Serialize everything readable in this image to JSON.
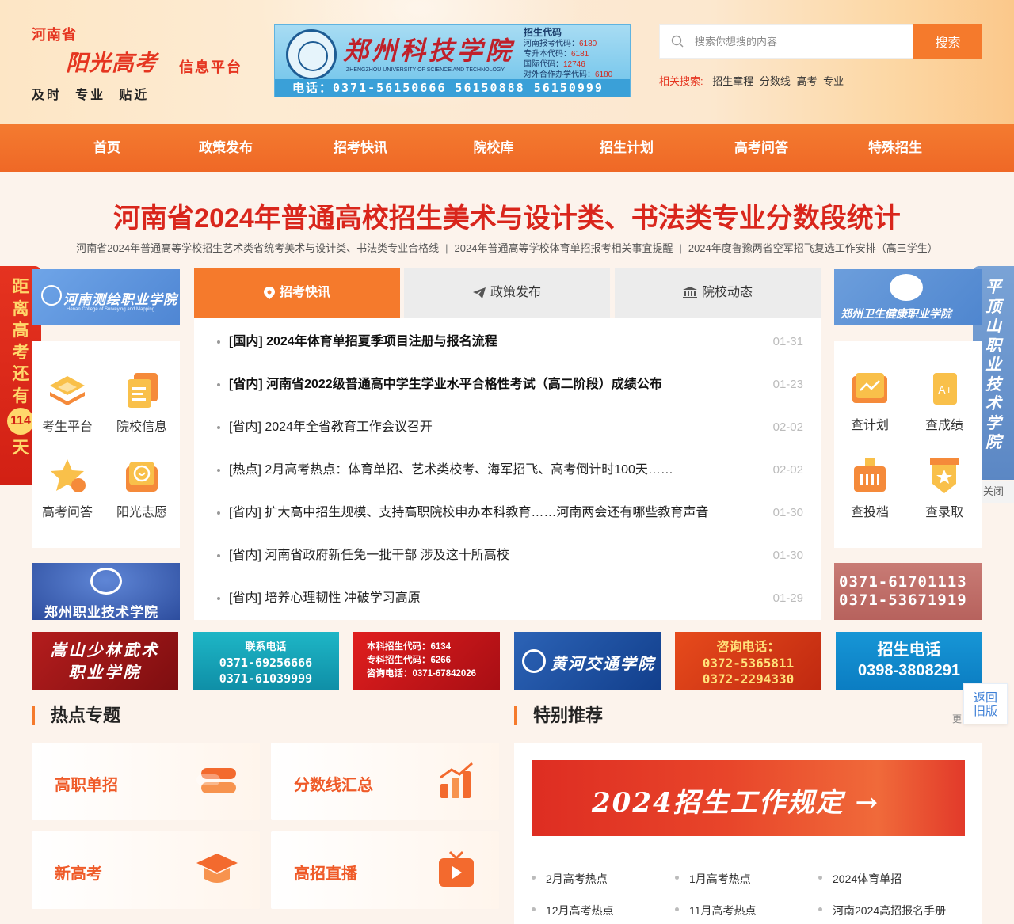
{
  "header": {
    "logo_province": "河南省",
    "logo_title": "阳光高考",
    "logo_subtitle": "信息平台",
    "logo_slogan": "及时  专业  贴近",
    "top_ad": {
      "school_name": "郑州科技学院",
      "school_name_en": "ZHENGZHOU UNIVERSITY OF SCIENCE AND TECHNOLOGY",
      "codes_title": "招生代码",
      "codes": [
        {
          "label": "河南报考代码：",
          "value": "6180"
        },
        {
          "label": "专升本代码：",
          "value": "6181"
        },
        {
          "label": "国际代码：",
          "value": "12746"
        },
        {
          "label": "对外合作办学代码：",
          "value": "6180"
        }
      ],
      "phone": "电话：0371-56150666  56150888  56150999"
    },
    "search": {
      "placeholder": "搜索你想搜的内容",
      "button": "搜索",
      "related_label": "相关搜索:",
      "related": [
        "招生章程",
        "分数线",
        "高考",
        "专业"
      ]
    }
  },
  "nav": [
    "首页",
    "政策发布",
    "招考快讯",
    "院校库",
    "招生计划",
    "高考问答",
    "特殊招生"
  ],
  "headline": "河南省2024年普通高校招生美术与设计类、书法类专业分数段统计",
  "sublinks": [
    "河南省2024年普通高等学校招生艺术类省统考美术与设计类、书法类专业合格线",
    "2024年普通高等学校体育单招报考相关事宜提醒",
    "2024年度鲁豫两省空军招飞复选工作安排（高三学生）"
  ],
  "sublink_sep": "|",
  "countdown": {
    "chars_top": [
      "距",
      "离",
      "高",
      "考",
      "还",
      "有"
    ],
    "days": "114",
    "chars_bottom": [
      "天"
    ]
  },
  "right_float_ad": {
    "chars": [
      "平",
      "顶",
      "山",
      "职",
      "业",
      "技",
      "术",
      "学",
      "院"
    ],
    "close": "关闭"
  },
  "ads": {
    "chsr": "河南测绘职业学院",
    "chsr_en": "Henan College of Surveying and Mapping",
    "zzws": "郑州卫生健康职业学院",
    "zzzy": "郑州职业技术学院",
    "phone_box": [
      "0371-61701113",
      "0371-53671919"
    ],
    "strip": {
      "s1": [
        "嵩山少林武术",
        "职业学院"
      ],
      "s2_head": "联系电话",
      "s2": [
        "0371-69256666",
        "0371-61039999"
      ],
      "s3": [
        "本科招生代码：6134",
        "专科招生代码：6266",
        "咨询电话：0371-67842026"
      ],
      "s4": "黄河交通学院",
      "s5_head": "咨询电话：",
      "s5": [
        "0372-5365811",
        "0372-2294330"
      ],
      "s6": [
        "招生电话",
        "0398-3808291"
      ]
    }
  },
  "quick_left": [
    "考生平台",
    "院校信息",
    "高考问答",
    "阳光志愿"
  ],
  "quick_right": [
    "查计划",
    "查成绩",
    "查投档",
    "查录取"
  ],
  "tabs": [
    "招考快讯",
    "政策发布",
    "院校动态"
  ],
  "news": [
    {
      "title": "[国内]  2024年体育单招夏季项目注册与报名流程",
      "date": "01-31",
      "bold": true
    },
    {
      "title": "[省内]  河南省2022级普通高中学生学业水平合格性考试（高二阶段）成绩公布",
      "date": "01-23",
      "bold": true
    },
    {
      "title": "[省内]  2024年全省教育工作会议召开",
      "date": "02-02",
      "bold": false
    },
    {
      "title": "[热点]  2月高考热点：体育单招、艺术类校考、海军招飞、高考倒计时100天……",
      "date": "02-02",
      "bold": false
    },
    {
      "title": "[省内]  扩大高中招生规模、支持高职院校申办本科教育……河南两会还有哪些教育声音",
      "date": "01-30",
      "bold": false
    },
    {
      "title": "[省内]  河南省政府新任免一批干部 涉及这十所高校",
      "date": "01-30",
      "bold": false
    },
    {
      "title": "[省内]  培养心理韧性 冲破学习高原",
      "date": "01-29",
      "bold": false
    }
  ],
  "hot_topics": {
    "title": "热点专题",
    "items": [
      "高职单招",
      "分数线汇总",
      "新高考",
      "高招直播"
    ]
  },
  "recommend": {
    "title": "特别推荐",
    "more": "更",
    "banner": "2024招生工作规定 →",
    "links": [
      "2月高考热点",
      "1月高考热点",
      "2024体育单招",
      "12月高考热点",
      "11月高考热点",
      "河南2024高招报名手册"
    ]
  },
  "old_version": [
    "返回",
    "旧版"
  ],
  "colors": {
    "brand_orange": "#f57a2c",
    "headline_red": "#d9261c",
    "accent_red": "#e53520"
  }
}
